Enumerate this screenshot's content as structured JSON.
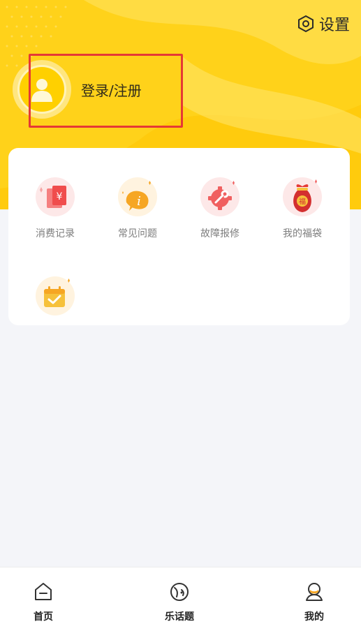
{
  "header": {
    "settings_label": "设置",
    "settings_icon": "hexagon-gear-icon",
    "login_label": "登录/注册",
    "avatar_icon": "user-avatar-icon",
    "accent_color": "#ffd21a"
  },
  "services": {
    "items": [
      {
        "label": "消费记录",
        "icon": "receipt-yen-icon"
      },
      {
        "label": "常见问题",
        "icon": "info-bubble-icon"
      },
      {
        "label": "故障报修",
        "icon": "wrench-gear-icon"
      },
      {
        "label": "我的福袋",
        "icon": "lucky-bag-icon"
      },
      {
        "label": "",
        "icon": "calendar-check-icon"
      }
    ]
  },
  "tabbar": {
    "items": [
      {
        "label": "首页",
        "icon": "home-icon"
      },
      {
        "label": "乐话题",
        "icon": "topic-face-icon"
      },
      {
        "label": "我的",
        "icon": "profile-icon"
      }
    ]
  }
}
